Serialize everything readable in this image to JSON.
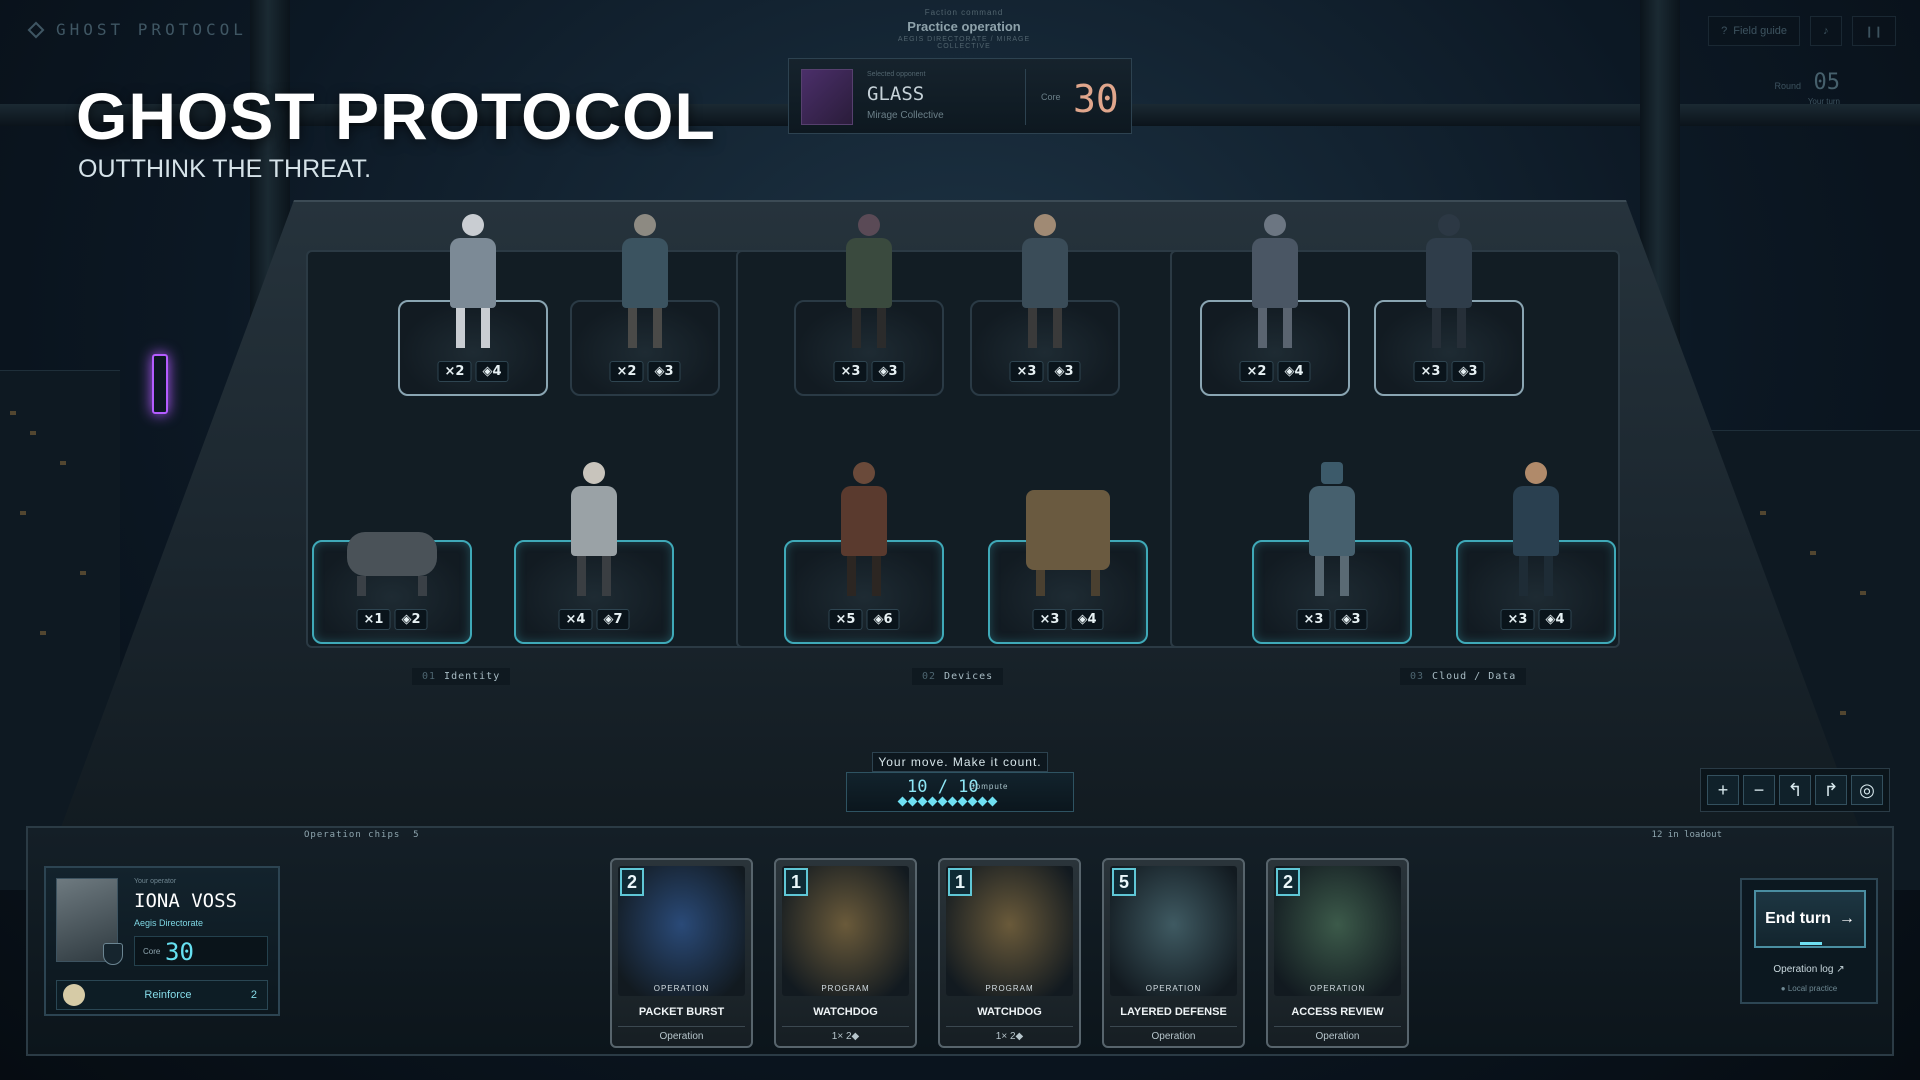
{
  "topbar": {
    "brand": "GHOST PROTOCOL",
    "faction_kicker": "Faction command",
    "mode_title": "Practice operation",
    "mode_sub": "AEGIS DIRECTORATE / MIRAGE COLLECTIVE",
    "field_guide": "Field guide",
    "round_label": "Round",
    "round_value": "05",
    "turn_label": "Your turn"
  },
  "hero": {
    "title": "GHOST PROTOCOL",
    "tagline": "OUTTHINK THE THREAT."
  },
  "opponent": {
    "kicker": "Selected opponent",
    "name": "GLASS",
    "faction": "Mirage Collective",
    "core_label": "Core",
    "core_value": "30"
  },
  "lanes": [
    {
      "num": "01",
      "label": "Identity"
    },
    {
      "num": "02",
      "label": "Devices"
    },
    {
      "num": "03",
      "label": "Cloud / Data"
    }
  ],
  "enemy_units": [
    {
      "mult": "×2",
      "power": "◈4"
    },
    {
      "mult": "×2",
      "power": "◈3"
    },
    {
      "mult": "×3",
      "power": "◈3"
    },
    {
      "mult": "×3",
      "power": "◈3"
    },
    {
      "mult": "×2",
      "power": "◈4"
    },
    {
      "mult": "×3",
      "power": "◈3"
    }
  ],
  "player_units": [
    {
      "mult": "×1",
      "power": "◈2"
    },
    {
      "mult": "×4",
      "power": "◈7"
    },
    {
      "mult": "×5",
      "power": "◈6"
    },
    {
      "mult": "×3",
      "power": "◈4"
    },
    {
      "mult": "×3",
      "power": "◈3"
    },
    {
      "mult": "×3",
      "power": "◈4"
    }
  ],
  "compute": {
    "prompt": "Your move. Make it count.",
    "value": "10 / 10",
    "label": "Compute",
    "pips": 10
  },
  "zoom": {
    "plus": "+",
    "minus": "−",
    "rotate_left": "↰",
    "rotate_right": "↱",
    "focus": "◎"
  },
  "hud": {
    "chips_label": "Operation chips",
    "chips_count": "5",
    "loadout": "12 in loadout"
  },
  "operator": {
    "kicker": "Your operator",
    "name": "IONA VOSS",
    "faction": "Aegis Directorate",
    "core_label": "Core",
    "core_value": "30",
    "reinforce_label": "Reinforce",
    "reinforce_count": "2"
  },
  "hand": [
    {
      "cost": "2",
      "type": "OPERATION",
      "name": "PACKET BURST",
      "foot": "Operation",
      "art": "#2a4a78"
    },
    {
      "cost": "1",
      "type": "PROGRAM",
      "name": "WATCHDOG",
      "foot": "1×  2◆",
      "art": "#6a5a3a"
    },
    {
      "cost": "1",
      "type": "PROGRAM",
      "name": "WATCHDOG",
      "foot": "1×  2◆",
      "art": "#6a5a3a"
    },
    {
      "cost": "5",
      "type": "OPERATION",
      "name": "LAYERED DEFENSE",
      "foot": "Operation",
      "art": "#3f5a62"
    },
    {
      "cost": "2",
      "type": "OPERATION",
      "name": "ACCESS REVIEW",
      "foot": "Operation",
      "art": "#3c5a4a"
    }
  ],
  "endturn": {
    "label": "End turn",
    "arrow": "→",
    "log": "Operation log ↗",
    "local": "● Local practice"
  }
}
